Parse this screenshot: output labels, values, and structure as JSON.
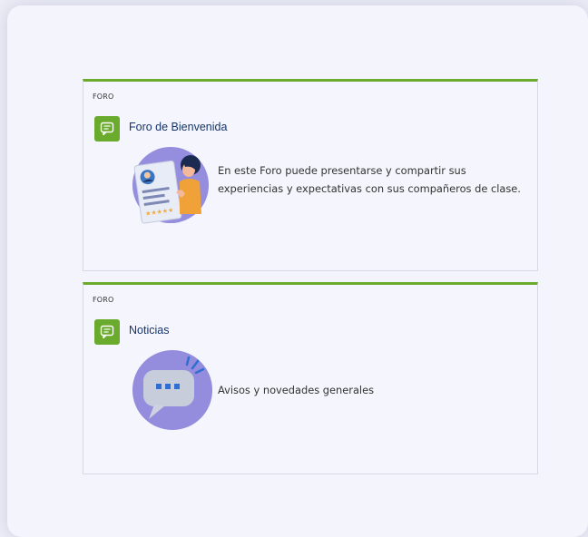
{
  "forums": [
    {
      "kind": "FORO",
      "title": "Foro de Bienvenida",
      "description": "En este Foro puede presentarse y compartir sus experiencias y expectativas con sus compañeros de clase.",
      "icon": "forum-icon",
      "illustration": "profile-card-illustration"
    },
    {
      "kind": "FORO",
      "title": "Noticias",
      "description": "Avisos y novedades generales",
      "icon": "forum-icon",
      "illustration": "chat-bubble-illustration"
    }
  ],
  "colors": {
    "accent": "#6aab2e",
    "title": "#16356a",
    "background": "#f4f4fc"
  }
}
